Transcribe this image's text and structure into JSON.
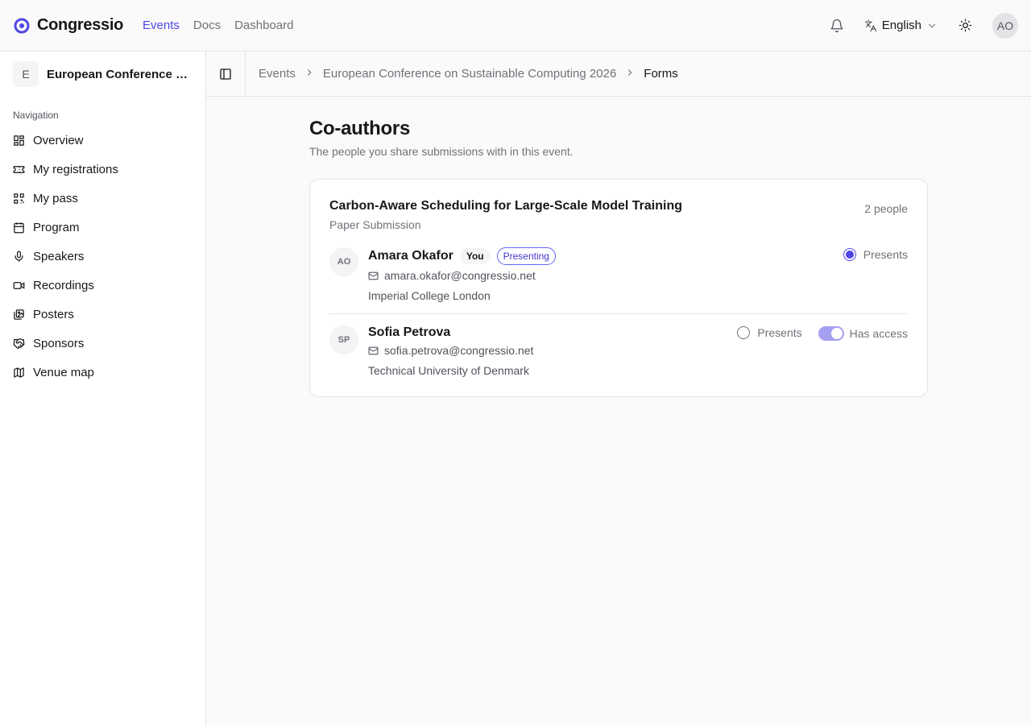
{
  "header": {
    "brand": "Congressio",
    "nav": [
      {
        "label": "Events",
        "active": true
      },
      {
        "label": "Docs",
        "active": false
      },
      {
        "label": "Dashboard",
        "active": false
      }
    ],
    "language": "English",
    "user_initials": "AO",
    "accent_color": "#4f46e5"
  },
  "sidebar": {
    "event_initial": "E",
    "event_name": "European Conference on Sustainable Computing 2026",
    "nav_heading": "Navigation",
    "items": [
      {
        "label": "Overview",
        "icon": "dashboard-icon"
      },
      {
        "label": "My registrations",
        "icon": "ticket-icon"
      },
      {
        "label": "My pass",
        "icon": "qr-code-icon"
      },
      {
        "label": "Program",
        "icon": "calendar-icon"
      },
      {
        "label": "Speakers",
        "icon": "microphone-icon"
      },
      {
        "label": "Recordings",
        "icon": "video-icon"
      },
      {
        "label": "Posters",
        "icon": "images-icon"
      },
      {
        "label": "Sponsors",
        "icon": "handshake-icon"
      },
      {
        "label": "Venue map",
        "icon": "map-icon"
      }
    ]
  },
  "breadcrumb": [
    "Events",
    "European Conference on Sustainable Computing 2026",
    "Forms"
  ],
  "page": {
    "title": "Co-authors",
    "subtitle": "The people you share submissions with in this event."
  },
  "submission": {
    "title": "Carbon-Aware Scheduling for Large-Scale Model Training",
    "type": "Paper Submission",
    "count": "2 people",
    "people": [
      {
        "initials": "AO",
        "name": "Amara Okafor",
        "you_badge": "You",
        "presenting_badge": "Presenting",
        "email": "amara.okafor@congressio.net",
        "org": "Imperial College London",
        "presents_label": "Presents",
        "presents_selected": true
      },
      {
        "initials": "SP",
        "name": "Sofia Petrova",
        "email": "sofia.petrova@congressio.net",
        "org": "Technical University of Denmark",
        "presents_label": "Presents",
        "presents_selected": false,
        "access_label": "Has access",
        "has_access": true
      }
    ]
  }
}
